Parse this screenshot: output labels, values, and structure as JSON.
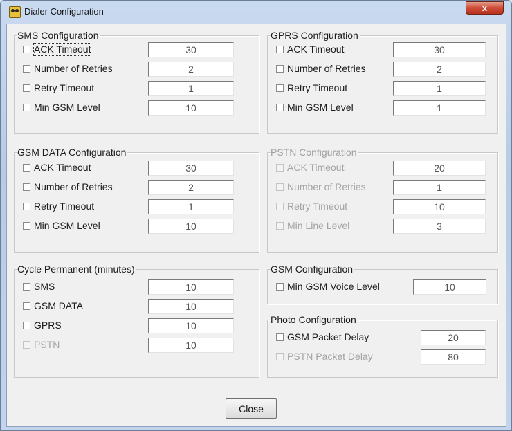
{
  "window": {
    "title": "Dialer Configuration",
    "close_glyph": "x"
  },
  "sms": {
    "title": "SMS Configuration",
    "rows": [
      {
        "label": "ACK Timeout",
        "value": "30"
      },
      {
        "label": "Number of Retries",
        "value": "2"
      },
      {
        "label": "Retry Timeout",
        "value": "1"
      },
      {
        "label": "Min GSM Level",
        "value": "10"
      }
    ]
  },
  "gprs": {
    "title": "GPRS Configuration",
    "rows": [
      {
        "label": "ACK Timeout",
        "value": "30"
      },
      {
        "label": "Number of Retries",
        "value": "2"
      },
      {
        "label": "Retry Timeout",
        "value": "1"
      },
      {
        "label": "Min GSM Level",
        "value": "1"
      }
    ]
  },
  "gsm_data": {
    "title": "GSM DATA Configuration",
    "rows": [
      {
        "label": "ACK Timeout",
        "value": "30"
      },
      {
        "label": "Number of Retries",
        "value": "2"
      },
      {
        "label": "Retry Timeout",
        "value": "1"
      },
      {
        "label": "Min GSM Level",
        "value": "10"
      }
    ]
  },
  "pstn": {
    "title": "PSTN Configuration",
    "rows": [
      {
        "label": "ACK Timeout",
        "value": "20"
      },
      {
        "label": "Number of Retries",
        "value": "1"
      },
      {
        "label": "Retry Timeout",
        "value": "10"
      },
      {
        "label": "Min Line Level",
        "value": "3"
      }
    ]
  },
  "cycle": {
    "title": "Cycle Permanent (minutes)",
    "rows": [
      {
        "label": "SMS",
        "value": "10"
      },
      {
        "label": "GSM DATA",
        "value": "10"
      },
      {
        "label": "GPRS",
        "value": "10"
      },
      {
        "label": "PSTN",
        "value": "10"
      }
    ]
  },
  "gsm_config": {
    "title": "GSM Configuration",
    "rows": [
      {
        "label": "Min GSM Voice Level",
        "value": "10"
      }
    ]
  },
  "photo": {
    "title": "Photo Configuration",
    "rows": [
      {
        "label": "GSM Packet Delay",
        "value": "20"
      },
      {
        "label": "PSTN Packet Delay",
        "value": "80"
      }
    ]
  },
  "buttons": {
    "close_label": "Close"
  }
}
